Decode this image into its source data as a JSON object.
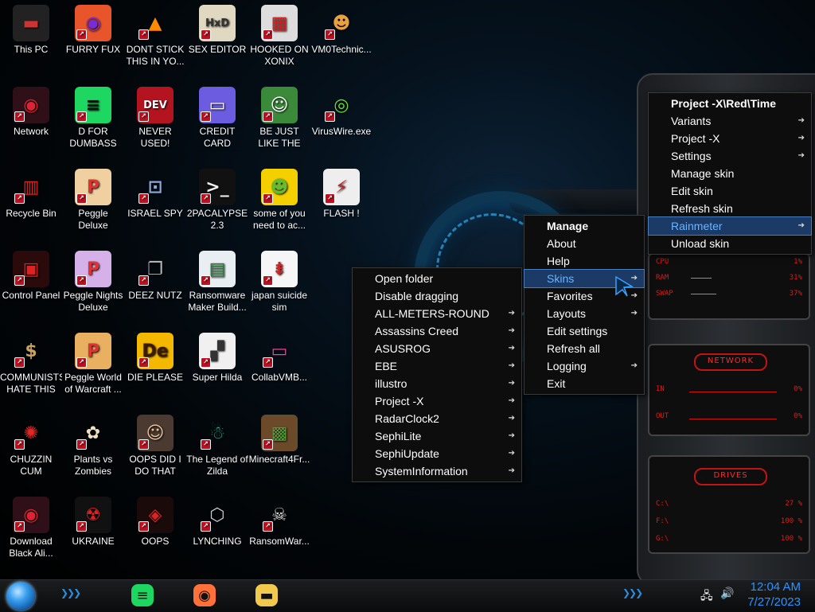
{
  "desktop": {
    "icons": [
      {
        "label": "This PC",
        "icon": "this-pc-icon",
        "bg": "#222",
        "glyph": "▬",
        "fg": "#c33"
      },
      {
        "label": "FURRY FUX",
        "icon": "firefox-icon",
        "bg": "#e8552a",
        "glyph": "◉",
        "fg": "#7a2ad8"
      },
      {
        "label": "DONT STICK THIS IN YO...",
        "icon": "vlc-cone-icon",
        "bg": "transparent",
        "glyph": "▲",
        "fg": "#ff8a00"
      },
      {
        "label": "SEX EDITOR",
        "icon": "hex-editor-icon",
        "bg": "#e0d8c0",
        "glyph": "HxD",
        "fg": "#333"
      },
      {
        "label": "HOOKED ON XONIX",
        "icon": "xonix-icon",
        "bg": "#ddd",
        "glyph": "▦",
        "fg": "#c22"
      },
      {
        "label": "VM0Technic...",
        "icon": "technician-icon",
        "bg": "transparent",
        "glyph": "☻",
        "fg": "#e8a040"
      },
      {
        "label": "Network",
        "icon": "network-icon",
        "bg": "#301018",
        "glyph": "◉",
        "fg": "#d23"
      },
      {
        "label": "D FOR DUMBASS",
        "icon": "spotify-icon",
        "bg": "#1ed760",
        "glyph": "≡",
        "fg": "#111"
      },
      {
        "label": "NEVER USED!",
        "icon": "dev-cpp-icon",
        "bg": "#b3141f",
        "glyph": "DEV",
        "fg": "#fff"
      },
      {
        "label": "CREDIT CARD CHECKER",
        "icon": "credit-card-icon",
        "bg": "#6b5ce0",
        "glyph": "▭",
        "fg": "#fff"
      },
      {
        "label": "BE JUST LIKE THE DUDE!",
        "icon": "gnome-dude-icon",
        "bg": "#3a8a3a",
        "glyph": "☺",
        "fg": "#fff"
      },
      {
        "label": "VirusWire.exe",
        "icon": "limewire-icon",
        "bg": "transparent",
        "glyph": "◎",
        "fg": "#6be034"
      },
      {
        "label": "Recycle Bin",
        "icon": "recycle-bin-icon",
        "bg": "transparent",
        "glyph": "▥",
        "fg": "#d22"
      },
      {
        "label": "Peggle Deluxe",
        "icon": "peggle-icon",
        "bg": "#f0d0a0",
        "glyph": "P",
        "fg": "#d33"
      },
      {
        "label": "ISRAEL SPY",
        "icon": "spy-network-icon",
        "bg": "transparent",
        "glyph": "⊡",
        "fg": "#8ad"
      },
      {
        "label": "2PACALYPSE 2.3",
        "icon": "terminal-icon",
        "bg": "#111",
        "glyph": ">_",
        "fg": "#eee"
      },
      {
        "label": "some of you need to ac...",
        "icon": "beaver-icon",
        "bg": "#f5d000",
        "glyph": "☻",
        "fg": "#6b3"
      },
      {
        "label": "FLASH !",
        "icon": "flash-icon",
        "bg": "#eee",
        "glyph": "⚡",
        "fg": "#c22"
      },
      {
        "label": "Control Panel",
        "icon": "control-panel-icon",
        "bg": "#2a0a0a",
        "glyph": "▣",
        "fg": "#d22"
      },
      {
        "label": "Peggle Nights Deluxe",
        "icon": "peggle-nights-icon",
        "bg": "#d6b0e8",
        "glyph": "P",
        "fg": "#d33"
      },
      {
        "label": "DEEZ NUTZ",
        "icon": "stacked-windows-icon",
        "bg": "transparent",
        "glyph": "❐",
        "fg": "#bbb"
      },
      {
        "label": "Ransomware Maker Build...",
        "icon": "ransomware-builder-icon",
        "bg": "#e8eef2",
        "glyph": "▤",
        "fg": "#2a7a3a"
      },
      {
        "label": "japan suicide sim",
        "icon": "document-icon",
        "bg": "#f6f6f6",
        "glyph": "⇟",
        "fg": "#c22"
      },
      {
        "label": "COMMUNISTS HATE THIS G...",
        "icon": "money-bag-icon",
        "bg": "transparent",
        "glyph": "$",
        "fg": "#c8a060"
      },
      {
        "label": "Peggle World of Warcraft ...",
        "icon": "peggle-wow-icon",
        "bg": "#e8b060",
        "glyph": "P",
        "fg": "#d33"
      },
      {
        "label": "DIE PLEASE",
        "icon": "after-effects-icon",
        "bg": "#f5b800",
        "glyph": "De",
        "fg": "#3a1a00"
      },
      {
        "label": "Super Hilda",
        "icon": "pixel-cat-icon",
        "bg": "#f0f0f0",
        "glyph": "▞",
        "fg": "#333"
      },
      {
        "label": "CollabVMB...",
        "icon": "collabvm-icon",
        "bg": "transparent",
        "glyph": "▭",
        "fg": "#e44da0"
      },
      {
        "label": "CHUZZIN CUM",
        "icon": "chuzzle-icon",
        "bg": "transparent",
        "glyph": "✺",
        "fg": "#e02828"
      },
      {
        "label": "Plants vs Zombies",
        "icon": "flower-icon",
        "bg": "transparent",
        "glyph": "✿",
        "fg": "#f0e0c0"
      },
      {
        "label": "OOPS DID I DO THAT",
        "icon": "portrait-icon",
        "bg": "#4a3a30",
        "glyph": "☺",
        "fg": "#e8c0a0"
      },
      {
        "label": "The Legend of Zilda",
        "icon": "zelda-icon",
        "bg": "transparent",
        "glyph": "☃",
        "fg": "#2a8"
      },
      {
        "label": "Minecraft4Fr...",
        "icon": "minecraft-block-icon",
        "bg": "#6b4a2a",
        "glyph": "▩",
        "fg": "#5a9a3a"
      },
      {
        "label": "Download Black Ali...",
        "icon": "download-network-icon",
        "bg": "#301018",
        "glyph": "◉",
        "fg": "#d23"
      },
      {
        "label": "UKRAINE",
        "icon": "radiation-icon",
        "bg": "#111",
        "glyph": "☢",
        "fg": "#e02020"
      },
      {
        "label": "OOPS",
        "icon": "alienware-icon",
        "bg": "#1a0a0a",
        "glyph": "◈",
        "fg": "#d22"
      },
      {
        "label": "LYNCHING",
        "icon": "lynching-emblem-icon",
        "bg": "transparent",
        "glyph": "⬡",
        "fg": "#ccc"
      },
      {
        "label": "RansomWar...",
        "icon": "skull-icon",
        "bg": "transparent",
        "glyph": "☠",
        "fg": "#ddd"
      }
    ]
  },
  "skins_submenu": {
    "items": [
      {
        "label": "Open folder",
        "arrow": false
      },
      {
        "label": "Disable dragging",
        "arrow": false
      },
      {
        "label": "ALL-METERS-ROUND",
        "arrow": true
      },
      {
        "label": "Assassins Creed",
        "arrow": true
      },
      {
        "label": "ASUSROG",
        "arrow": true
      },
      {
        "label": "EBE",
        "arrow": true
      },
      {
        "label": "illustro",
        "arrow": true
      },
      {
        "label": "Project -X",
        "arrow": true
      },
      {
        "label": "RadarClock2",
        "arrow": true
      },
      {
        "label": "SephiLite",
        "arrow": true
      },
      {
        "label": "SephiUpdate",
        "arrow": true
      },
      {
        "label": "SystemInformation",
        "arrow": true
      }
    ]
  },
  "rainmeter_submenu": {
    "items": [
      {
        "label": "Manage",
        "arrow": false,
        "bold": true
      },
      {
        "label": "About",
        "arrow": false
      },
      {
        "label": "Help",
        "arrow": false
      },
      {
        "label": "Skins",
        "arrow": true,
        "highlighted": true
      },
      {
        "label": "Favorites",
        "arrow": true
      },
      {
        "label": "Layouts",
        "arrow": true
      },
      {
        "label": "Edit settings",
        "arrow": false
      },
      {
        "label": "Refresh all",
        "arrow": false
      },
      {
        "label": "Logging",
        "arrow": true
      },
      {
        "label": "Exit",
        "arrow": false
      }
    ]
  },
  "skin_menu": {
    "items": [
      {
        "label": "Project -X\\Red\\Time",
        "arrow": false,
        "bold": true
      },
      {
        "label": "Variants",
        "arrow": true
      },
      {
        "label": "Project -X",
        "arrow": true
      },
      {
        "label": "Settings",
        "arrow": true
      },
      {
        "label": "Manage skin",
        "arrow": false
      },
      {
        "label": "Edit skin",
        "arrow": false
      },
      {
        "label": "Refresh skin",
        "arrow": false
      },
      {
        "label": "Rainmeter",
        "arrow": true,
        "highlighted": true
      },
      {
        "label": "Unload skin",
        "arrow": false
      }
    ]
  },
  "widget": {
    "system": {
      "rows": [
        {
          "label": "CPU",
          "value": "1%"
        },
        {
          "label": "RAM",
          "value": "31%"
        },
        {
          "label": "SWAP",
          "value": "37%"
        }
      ]
    },
    "network": {
      "title": "NETWORK",
      "rows": [
        {
          "label": "IN",
          "value": "0%"
        },
        {
          "label": "OUT",
          "value": "0%"
        }
      ]
    },
    "drives": {
      "title": "DRIVES",
      "rows": [
        {
          "label": "C:\\",
          "value": "27 %"
        },
        {
          "label": "F:\\",
          "value": "100 %"
        },
        {
          "label": "G:\\",
          "value": "100 %"
        }
      ]
    }
  },
  "taskbar": {
    "apps": [
      {
        "name": "spotify",
        "icon": "spotify-icon",
        "color": "#1ed760"
      },
      {
        "name": "firefox",
        "icon": "firefox-icon",
        "color": "#ff7139"
      },
      {
        "name": "file-explorer",
        "icon": "folder-icon",
        "color": "#f2c94c"
      }
    ],
    "clock": {
      "time": "12:04 AM",
      "date": "7/27/2023"
    }
  },
  "colors": {
    "accent_blue": "#2b93ff",
    "menu_highlight": "#1b3a66",
    "skin_red": "#e01818"
  }
}
